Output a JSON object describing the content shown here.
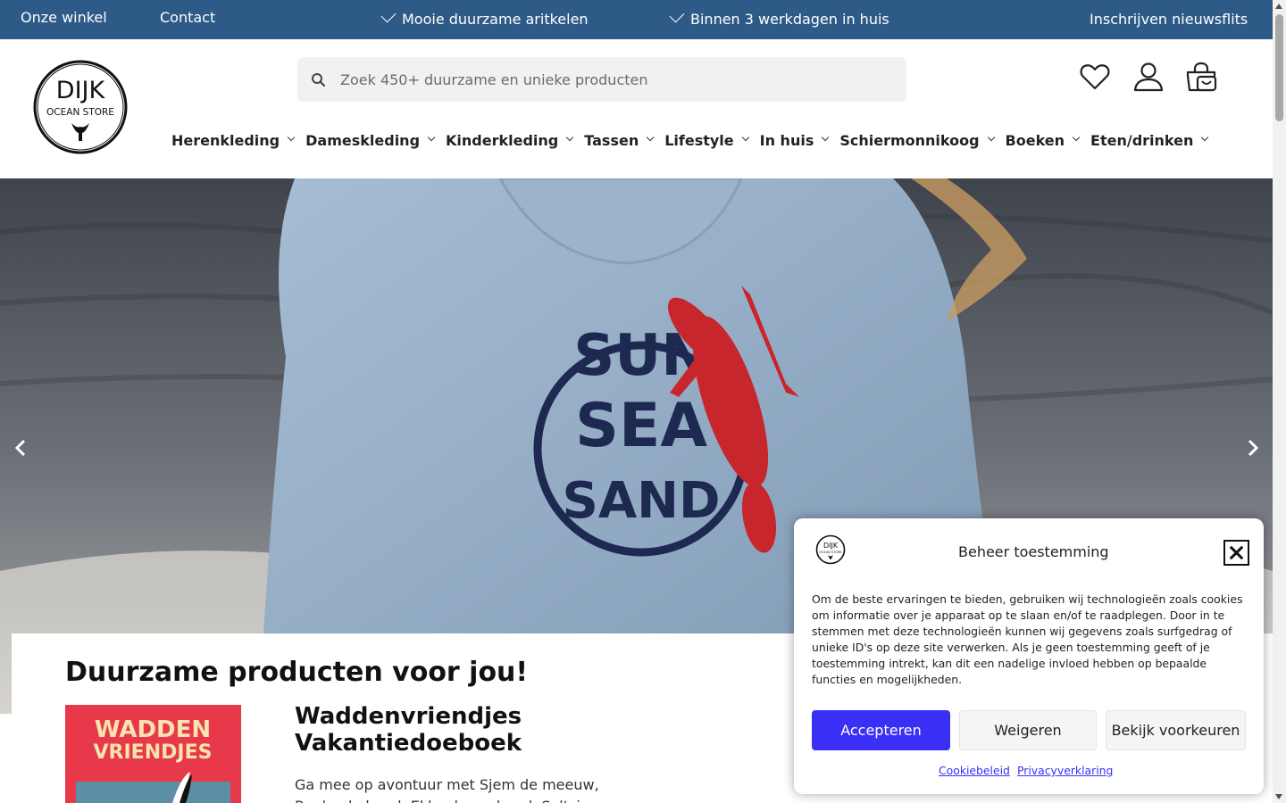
{
  "topbar": {
    "store": "Onze winkel",
    "contact": "Contact",
    "usp1": "Mooie duurzame aritkelen",
    "usp2": "Binnen 3 werkdagen in huis",
    "newsletter": "Inschrijven nieuwsflits"
  },
  "logo": {
    "line1": "DIJK",
    "line2": "OCEAN STORE"
  },
  "search": {
    "placeholder": "Zoek 450+ duurzame en unieke producten"
  },
  "header_icons": [
    "heart-icon",
    "user-icon",
    "basket-icon"
  ],
  "nav": {
    "items": [
      {
        "label": "Herenkleding"
      },
      {
        "label": "Dameskleding"
      },
      {
        "label": "Kinderkleding"
      },
      {
        "label": "Tassen"
      },
      {
        "label": "Lifestyle"
      },
      {
        "label": "In huis"
      },
      {
        "label": "Schiermonnikoog"
      },
      {
        "label": "Boeken"
      },
      {
        "label": "Eten/drinken"
      }
    ]
  },
  "hero": {
    "print": [
      "SUN",
      "SEA",
      "SAND"
    ]
  },
  "main": {
    "title": "Duurzame producten voor jou!",
    "book_cover_text": [
      "WADDEN",
      "VRIENDJES"
    ],
    "book_title": "Waddenvriendjes Vakantiedoeboek",
    "book_desc": "Ga mee op avontuur met Sjem de meeuw, Ruubs de hond, Ekke de zeehond, Saltsje"
  },
  "consent": {
    "title": "Beheer toestemming",
    "text": "Om de beste ervaringen te bieden, gebruiken wij technologieën zoals cookies om informatie over je apparaat op te slaan en/of te raadplegen. Door in te stemmen met deze technologieën kunnen wij gegevens zoals surfgedrag of unieke ID's op deze site verwerken. Als je geen toestemming geeft of je toestemming intrekt, kan dit een nadelige invloed hebben op bepaalde functies en mogelijkheden.",
    "accept": "Accepteren",
    "deny": "Weigeren",
    "prefs": "Bekijk voorkeuren",
    "cookie_policy": "Cookiebeleid",
    "privacy": "Privacyverklaring"
  },
  "colors": {
    "topbar": "#2d5a86",
    "accept": "#3a2ff5"
  }
}
